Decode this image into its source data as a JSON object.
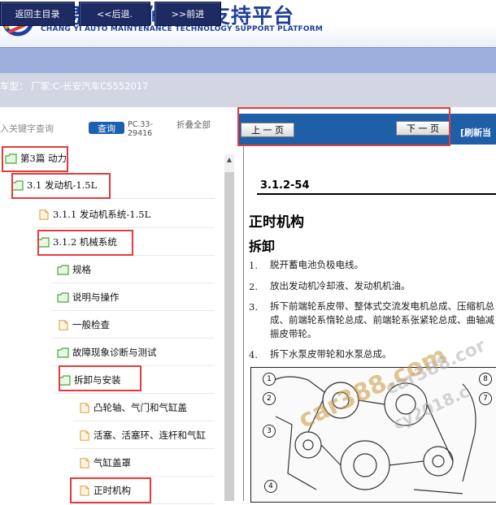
{
  "header": {
    "title": "畅易汽车维修技术支持平台",
    "subtitle": "CHANG YI AUTO MAINTENANCE TECHNOLOGY SUPPORT PLATFORM"
  },
  "nav": {
    "home": "返回主目录",
    "back": "<<后退.",
    "forward": ">>前进"
  },
  "model": {
    "text": "车型：  厂家:C-长安汽车CS552017"
  },
  "search": {
    "hint": "入关键字查询",
    "query_label": "查询",
    "code": "PC.33-29416",
    "collapse_label": "折叠全部"
  },
  "tree": [
    {
      "label": "第3篇 动力",
      "type": "folder"
    },
    {
      "label": "3.1 发动机-1.5L",
      "type": "folder"
    },
    {
      "label": "3.1.1 发动机系统-1.5L",
      "type": "doc"
    },
    {
      "label": "3.1.2 机械系统",
      "type": "folder"
    },
    {
      "label": "规格",
      "type": "folder"
    },
    {
      "label": "说明与操作",
      "type": "folder"
    },
    {
      "label": "一般检查",
      "type": "doc"
    },
    {
      "label": "故障现象诊断与测试",
      "type": "folder"
    },
    {
      "label": "拆卸与安装",
      "type": "folder"
    },
    {
      "label": "凸轮轴、气门和气缸盖",
      "type": "doc"
    },
    {
      "label": "活塞、活塞环、连杆和气缸",
      "type": "doc"
    },
    {
      "label": "气缸盖罩",
      "type": "doc"
    },
    {
      "label": "正时机构",
      "type": "doc"
    }
  ],
  "doc": {
    "prev_label": "上 一 页",
    "next_label": "下 一 页",
    "refresh_label": "[刷新当",
    "code": "3.1.2-54",
    "h1": "正时机构",
    "h2": "拆卸",
    "steps": [
      {
        "num": "1.",
        "text": "脱开蓄电池负极电线。"
      },
      {
        "num": "2.",
        "text": "放出发动机冷却液、发动机机油。"
      },
      {
        "num": "3.",
        "text": "拆下前端轮系皮带、整体式交流发电机总成、压缩机总成、前端轮系惰轮总成、前端轮系张紧轮总成、曲轴减振皮带轮。"
      },
      {
        "num": "4.",
        "text": "拆下水泵皮带轮和水泵总成。"
      }
    ],
    "figure_callouts": [
      "1",
      "2",
      "3",
      "4",
      "8",
      "7"
    ]
  },
  "watermarks": [
    "car388.com",
    "car388.cor",
    "cy2018.c"
  ],
  "colors": {
    "brand_blue": "#1d3f9b",
    "nav_button": "#1e2b63",
    "doc_toolbar": "#1f5fa8",
    "highlight_red": "#e23b3b"
  }
}
